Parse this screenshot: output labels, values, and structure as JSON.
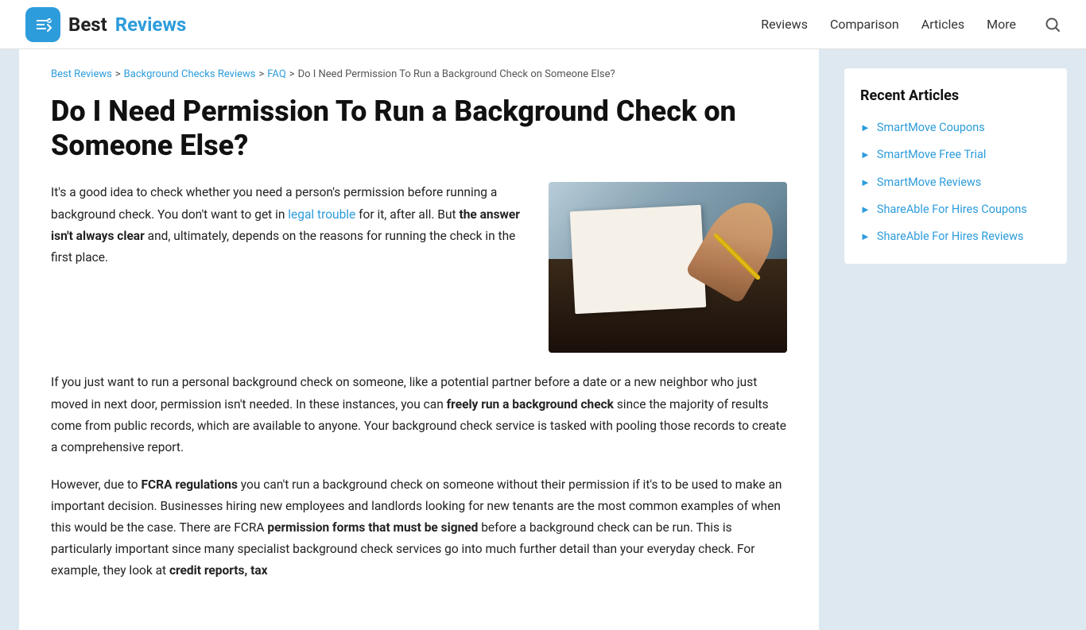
{
  "header": {
    "logo_text_best": "Best",
    "logo_text_reviews": "Reviews",
    "nav": [
      {
        "label": "Reviews",
        "href": "#"
      },
      {
        "label": "Comparison",
        "href": "#"
      },
      {
        "label": "Articles",
        "href": "#"
      },
      {
        "label": "More",
        "href": "#"
      }
    ]
  },
  "breadcrumb": {
    "items": [
      {
        "label": "Best Reviews",
        "href": "#"
      },
      {
        "label": "Background Checks Reviews",
        "href": "#"
      },
      {
        "label": "FAQ",
        "href": "#"
      },
      {
        "label": "Do I Need Permission To Run a Background Check on Someone Else?",
        "href": null
      }
    ]
  },
  "article": {
    "title": "Do I Need Permission To Run a Background Check on Someone Else?",
    "intro": {
      "paragraph": "It's a good idea to check whether you need a person's permission before running a background check. You don't want to get in",
      "link_text": "legal trouble",
      "link_href": "#",
      "paragraph_after": "for it, after all. But",
      "bold_text": "the answer isn't always clear",
      "paragraph_end": "and, ultimately, depends on the reasons for running the check in the first place."
    },
    "paragraph2": "If you just want to run a personal background check on someone, like a potential partner before a date or a new neighbor who just moved in next door, permission isn't needed. In these instances, you can",
    "paragraph2_bold": "freely run a background check",
    "paragraph2_end": "since the majority of results come from public records, which are available to anyone. Your background check service is tasked with pooling those records to create a comprehensive report.",
    "paragraph3_start": "However, due to",
    "paragraph3_bold1": "FCRA regulations",
    "paragraph3_mid": "you can't run a background check on someone without their permission if it's to be used to make an important decision. Businesses hiring new employees and landlords looking for new tenants are the most common examples of when this would be the case. There are FCRA",
    "paragraph3_bold2": "permission forms that must be signed",
    "paragraph3_end": "before a background check can be run. This is particularly important since many specialist background check services go into much further detail than your everyday check. For example, they look at",
    "paragraph3_bold3": "credit reports, tax"
  },
  "sidebar": {
    "title": "Recent Articles",
    "items": [
      {
        "label": "SmartMove Coupons",
        "href": "#"
      },
      {
        "label": "SmartMove Free Trial",
        "href": "#"
      },
      {
        "label": "SmartMove Reviews",
        "href": "#"
      },
      {
        "label": "ShareAble For Hires Coupons",
        "href": "#"
      },
      {
        "label": "ShareAble For Hires Reviews",
        "href": "#"
      }
    ]
  }
}
